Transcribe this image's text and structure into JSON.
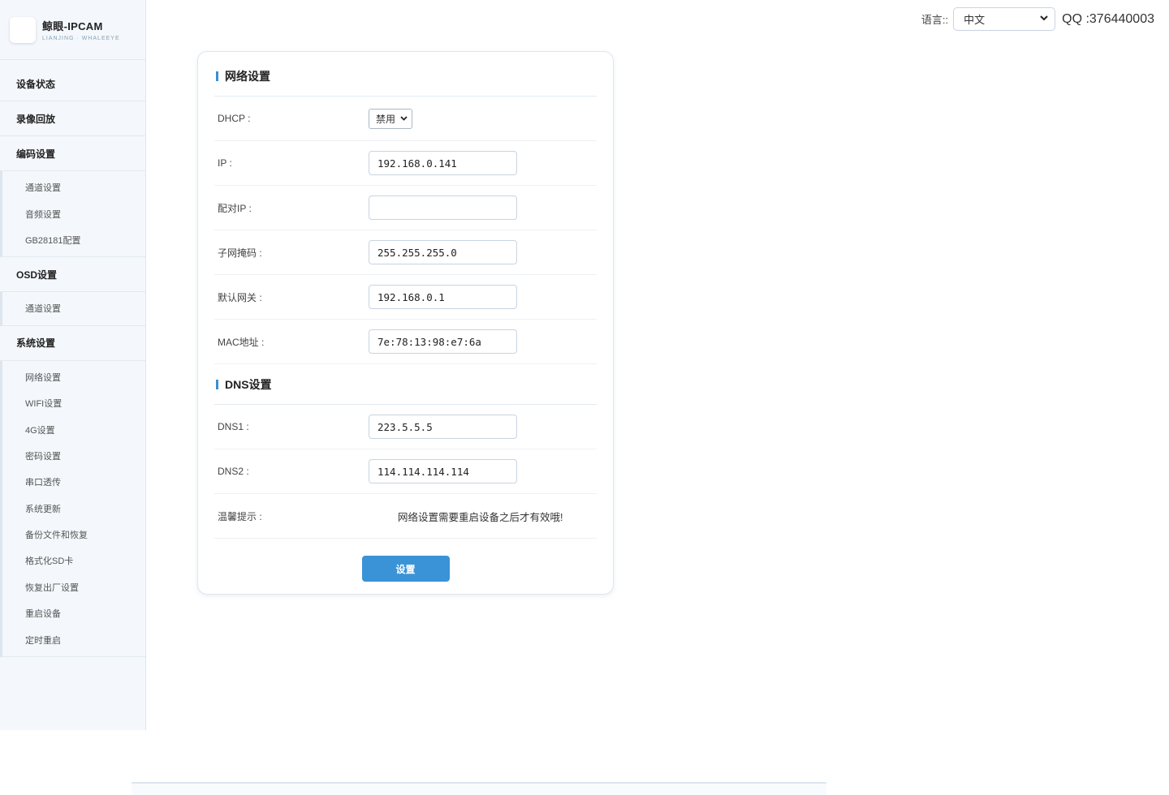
{
  "brand": {
    "title": "鲸眼-IPCAM",
    "subtitle": "LIANJING · WHALEEYE"
  },
  "sidebar": {
    "groups": [
      {
        "label": "设备状态",
        "items": []
      },
      {
        "label": "录像回放",
        "items": []
      },
      {
        "label": "编码设置",
        "items": [
          "通道设置",
          "音频设置",
          "GB28181配置"
        ]
      },
      {
        "label": "OSD设置",
        "items": [
          "通道设置"
        ]
      },
      {
        "label": "系统设置",
        "items": [
          "网络设置",
          "WIFI设置",
          "4G设置",
          "密码设置",
          "串口透传",
          "系统更新",
          "备份文件和恢复",
          "格式化SD卡",
          "恢复出厂设置",
          "重启设备",
          "定时重启"
        ]
      }
    ]
  },
  "topbar": {
    "lang_label": "语言::",
    "lang_value": "中文",
    "qq": "QQ :376440003"
  },
  "network": {
    "title": "网络设置",
    "dhcp_label": "DHCP :",
    "dhcp_value": "禁用",
    "fields": [
      {
        "label": "IP :",
        "value": "192.168.0.141"
      },
      {
        "label": "配对IP :",
        "value": ""
      },
      {
        "label": "子网掩码 :",
        "value": "255.255.255.0"
      },
      {
        "label": "默认网关 :",
        "value": "192.168.0.1"
      },
      {
        "label": "MAC地址 :",
        "value": "7e:78:13:98:e7:6a"
      }
    ]
  },
  "dns": {
    "title": "DNS设置",
    "fields": [
      {
        "label": "DNS1 :",
        "value": "223.5.5.5"
      },
      {
        "label": "DNS2 :",
        "value": "114.114.114.114"
      }
    ],
    "tip_label": "温馨提示 :",
    "tip_text": "网络设置需要重启设备之后才有效哦!"
  },
  "submit_label": "设置",
  "colors": {
    "accent": "#3a93d6",
    "sidebar_bg": "#f4f8fc"
  }
}
